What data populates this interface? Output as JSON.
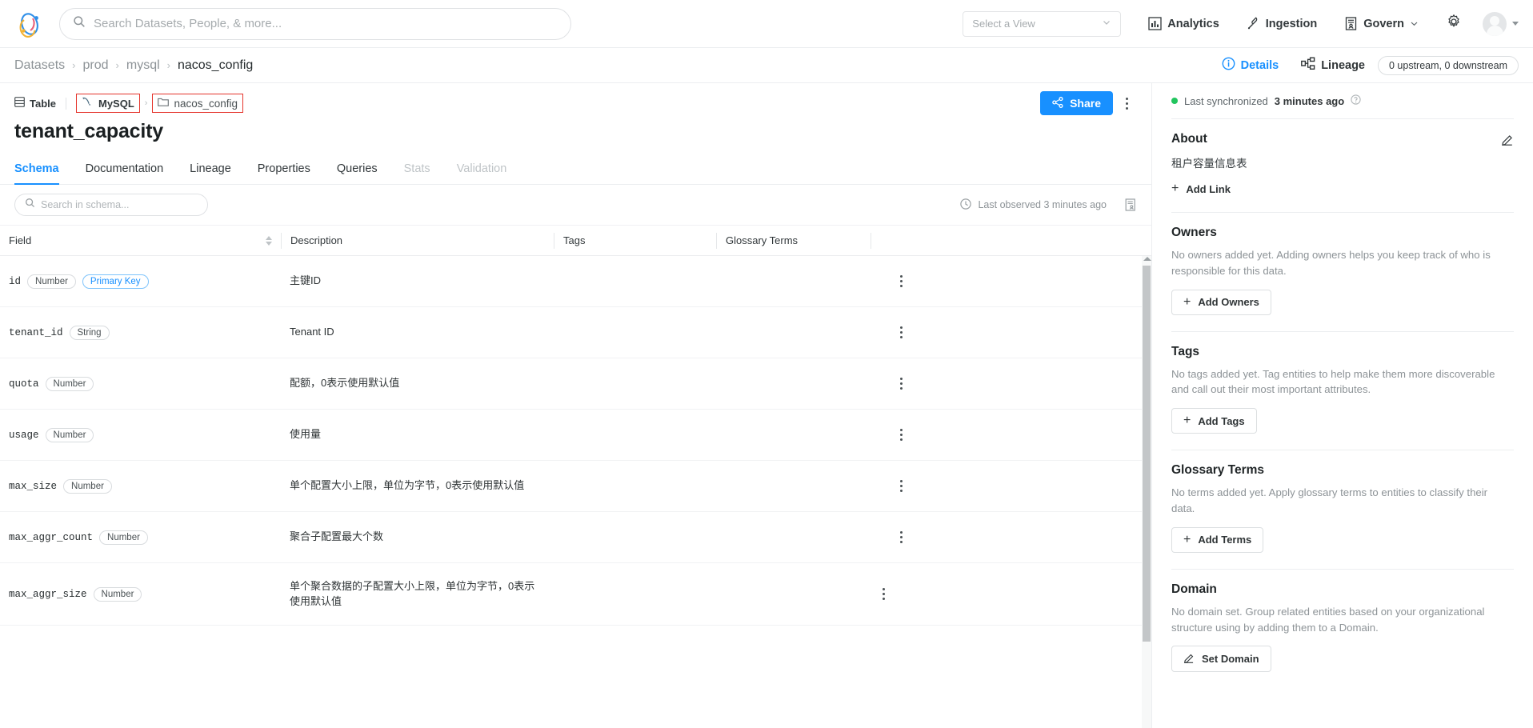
{
  "topnav": {
    "logo_name": "datahub-logo",
    "search": {
      "placeholder": "Search Datasets, People, & more...",
      "value": ""
    },
    "view_select": {
      "label": "Select a View"
    },
    "items": [
      {
        "label": "Analytics",
        "icon": "bar-chart-icon"
      },
      {
        "label": "Ingestion",
        "icon": "plug-icon"
      },
      {
        "label": "Govern",
        "icon": "governance-icon",
        "has_caret": true
      }
    ],
    "settings_icon": "gear-icon",
    "avatar_icon": "user-avatar"
  },
  "breadcrumb": {
    "items": [
      "Datasets",
      "prod",
      "mysql",
      "nacos_config"
    ],
    "separator": "›",
    "right": {
      "details_label": "Details",
      "lineage_label": "Lineage",
      "lineage_count": "0 upstream, 0 downstream"
    }
  },
  "entity": {
    "type_label": "Table",
    "platform_label": "MySQL",
    "container_label": "nacos_config",
    "title": "tenant_capacity",
    "share_label": "Share",
    "highlight_color": "#e5342b"
  },
  "tabs": [
    {
      "label": "Schema",
      "selected": true,
      "disabled": false
    },
    {
      "label": "Documentation",
      "selected": false,
      "disabled": false
    },
    {
      "label": "Lineage",
      "selected": false,
      "disabled": false
    },
    {
      "label": "Properties",
      "selected": false,
      "disabled": false
    },
    {
      "label": "Queries",
      "selected": false,
      "disabled": false
    },
    {
      "label": "Stats",
      "selected": false,
      "disabled": true
    },
    {
      "label": "Validation",
      "selected": false,
      "disabled": true
    }
  ],
  "schema": {
    "search": {
      "placeholder": "Search in schema...",
      "value": ""
    },
    "last_observed": "Last observed 3 minutes ago",
    "columns": [
      "Field",
      "Description",
      "Tags",
      "Glossary Terms"
    ],
    "rows": [
      {
        "field": "id",
        "type": "Number",
        "primary_key": "Primary Key",
        "description": "主键ID",
        "tags": "",
        "glossary": ""
      },
      {
        "field": "tenant_id",
        "type": "String",
        "primary_key": "",
        "description": "Tenant ID",
        "tags": "",
        "glossary": ""
      },
      {
        "field": "quota",
        "type": "Number",
        "primary_key": "",
        "description": "配额，0表示使用默认值",
        "tags": "",
        "glossary": ""
      },
      {
        "field": "usage",
        "type": "Number",
        "primary_key": "",
        "description": "使用量",
        "tags": "",
        "glossary": ""
      },
      {
        "field": "max_size",
        "type": "Number",
        "primary_key": "",
        "description": "单个配置大小上限，单位为字节，0表示使用默认值",
        "tags": "",
        "glossary": ""
      },
      {
        "field": "max_aggr_count",
        "type": "Number",
        "primary_key": "",
        "description": "聚合子配置最大个数",
        "tags": "",
        "glossary": ""
      },
      {
        "field": "max_aggr_size",
        "type": "Number",
        "primary_key": "",
        "description": "单个聚合数据的子配置大小上限，单位为字节，0表示使用默认值",
        "tags": "",
        "glossary": ""
      }
    ]
  },
  "sidebar": {
    "sync": {
      "prefix": "Last synchronized",
      "value": "3 minutes ago"
    },
    "about": {
      "title": "About",
      "text": "租户容量信息表",
      "add_link_label": "Add Link"
    },
    "owners": {
      "title": "Owners",
      "empty": "No owners added yet. Adding owners helps you keep track of who is responsible for this data.",
      "button": "Add Owners"
    },
    "tags": {
      "title": "Tags",
      "empty": "No tags added yet. Tag entities to help make them more discoverable and call out their most important attributes.",
      "button": "Add Tags"
    },
    "glossary": {
      "title": "Glossary Terms",
      "empty": "No terms added yet. Apply glossary terms to entities to classify their data.",
      "button": "Add Terms"
    },
    "domain": {
      "title": "Domain",
      "empty": "No domain set. Group related entities based on your organizational structure using by adding them to a Domain.",
      "button": "Set Domain"
    }
  },
  "colors": {
    "accent": "#1890ff",
    "green": "#22c55e",
    "highlight": "#e5342b"
  }
}
